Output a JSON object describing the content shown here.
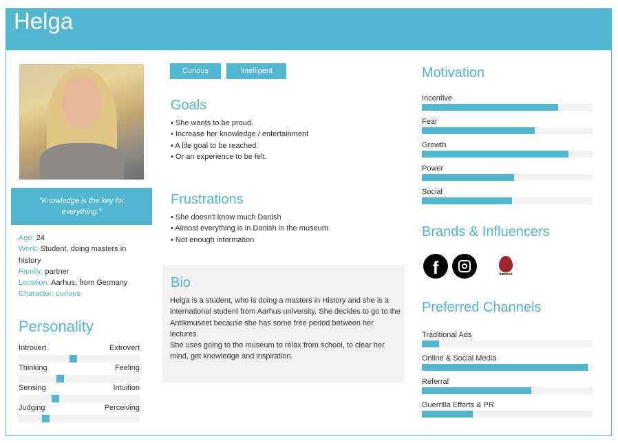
{
  "persona": {
    "name": "Helga",
    "quote": "\"Knowledge is the key for everything.\""
  },
  "facts": [
    {
      "label": "Age:",
      "value": " 24"
    },
    {
      "label": "Work:",
      "value": " Student, doing masters in history"
    },
    {
      "label": "Family:",
      "value": " partner"
    },
    {
      "label": "Location:",
      "value": " Aarhus, from Germany"
    },
    {
      "label": "Character:",
      "value": " curious"
    }
  ],
  "personality": {
    "title": "Personality",
    "traits": [
      {
        "left": "Introvert",
        "right": "Extrovert",
        "value": 0.45
      },
      {
        "left": "Thinking",
        "right": "Feeling",
        "value": 0.34
      },
      {
        "left": "Sensing",
        "right": "Intuition",
        "value": 0.3
      },
      {
        "left": "Judging",
        "right": "Perceiving",
        "value": 0.22
      }
    ]
  },
  "tags": [
    "Curious",
    "Intelligent"
  ],
  "goals": {
    "title": "Goals",
    "items": [
      "She wants to be proud.",
      "Increase her knowledge / entertainment",
      "A life goal to be reached.",
      "Or an experience to be felt."
    ]
  },
  "frustrations": {
    "title": "Frustrations",
    "items": [
      "She doesn't know much Danish",
      "Almost everything is in Danish in the museum",
      "Not enough information"
    ]
  },
  "bio": {
    "title": "Bio",
    "paragraphs": [
      "Helga is a student, who is doing a masters in History and she is a international student from Aarhus university. She decides to go to the Antikmuseet because she has some free period between her lectures.",
      "She uses going to the museum to relax from school, to clear her mind, get knowledge and inspiration."
    ]
  },
  "motivation": {
    "title": "Motivation",
    "items": [
      {
        "label": "Incentive",
        "percent": 80
      },
      {
        "label": "Fear",
        "percent": 66
      },
      {
        "label": "Growth",
        "percent": 86
      },
      {
        "label": "Power",
        "percent": 54
      },
      {
        "label": "Social",
        "percent": 53
      }
    ]
  },
  "brands": {
    "title": "Brands & Influencers",
    "logos": [
      "facebook-icon",
      "instagram-icon",
      "baresso-logo"
    ],
    "baresso_text": "baresso"
  },
  "channels": {
    "title": "Preferred Channels",
    "items": [
      {
        "label": "Traditional Ads",
        "percent": 10
      },
      {
        "label": "Online & Social Media",
        "percent": 97
      },
      {
        "label": "Referral",
        "percent": 64
      },
      {
        "label": "Guerrilla Efforts & PR",
        "percent": 30
      }
    ]
  },
  "colors": {
    "accent": "#52b6d1",
    "track": "#f2f2f2"
  }
}
